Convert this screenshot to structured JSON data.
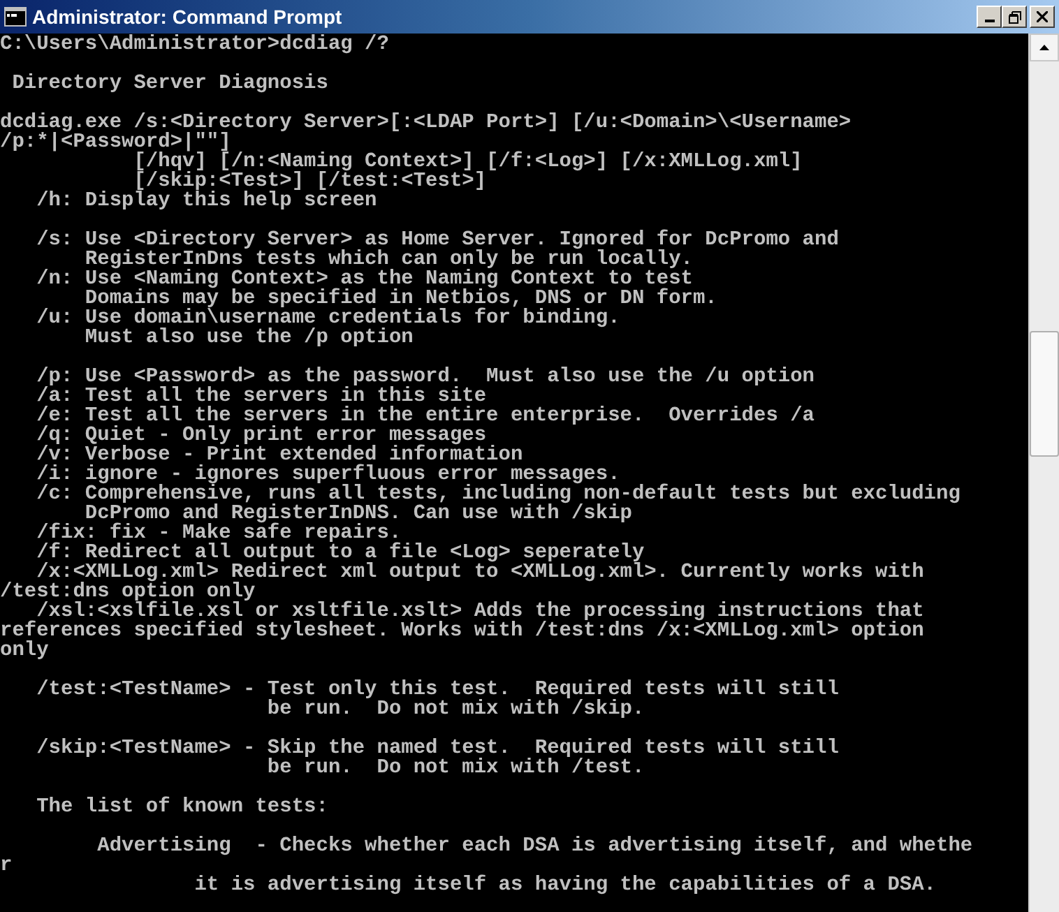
{
  "window": {
    "title": "Administrator: Command Prompt"
  },
  "console": {
    "blocks": [
      {
        "lines": [
          "C:\\Users\\Administrator>dcdiag /?"
        ]
      },
      {
        "lines": [
          " Directory Server Diagnosis"
        ]
      },
      {
        "lines": [
          "dcdiag.exe /s:<Directory Server>[:<LDAP Port>] [/u:<Domain>\\<Username>",
          "/p:*|<Password>|\"\"]",
          "           [/hqv] [/n:<Naming Context>] [/f:<Log>] [/x:XMLLog.xml]",
          "           [/skip:<Test>] [/test:<Test>]",
          "   /h: Display this help screen"
        ]
      },
      {
        "lines": [
          "   /s: Use <Directory Server> as Home Server. Ignored for DcPromo and",
          "       RegisterInDns tests which can only be run locally.",
          "   /n: Use <Naming Context> as the Naming Context to test",
          "       Domains may be specified in Netbios, DNS or DN form.",
          "   /u: Use domain\\username credentials for binding.",
          "       Must also use the /p option"
        ]
      },
      {
        "lines": [
          "   /p: Use <Password> as the password.  Must also use the /u option",
          "   /a: Test all the servers in this site",
          "   /e: Test all the servers in the entire enterprise.  Overrides /a",
          "   /q: Quiet - Only print error messages",
          "   /v: Verbose - Print extended information",
          "   /i: ignore - ignores superfluous error messages.",
          "   /c: Comprehensive, runs all tests, including non-default tests but excluding",
          "       DcPromo and RegisterInDNS. Can use with /skip",
          "   /fix: fix - Make safe repairs.",
          "   /f: Redirect all output to a file <Log> seperately",
          "   /x:<XMLLog.xml> Redirect xml output to <XMLLog.xml>. Currently works with",
          "/test:dns option only",
          "   /xsl:<xslfile.xsl or xsltfile.xslt> Adds the processing instructions that",
          "references specified stylesheet. Works with /test:dns /x:<XMLLog.xml> option",
          "only"
        ]
      },
      {
        "lines": [
          "   /test:<TestName> - Test only this test.  Required tests will still",
          "                      be run.  Do not mix with /skip."
        ]
      },
      {
        "lines": [
          "   /skip:<TestName> - Skip the named test.  Required tests will still",
          "                      be run.  Do not mix with /test."
        ]
      },
      {
        "lines": [
          "   The list of known tests:"
        ]
      },
      {
        "lines": [
          "        Advertising  - Checks whether each DSA is advertising itself, and whethe",
          "r",
          "                it is advertising itself as having the capabilities of a DSA."
        ]
      }
    ]
  }
}
